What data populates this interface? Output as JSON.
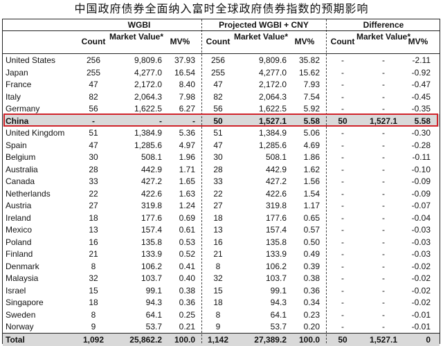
{
  "title": "中国政府债券全面纳入富时全球政府债券指数的预期影响",
  "groups": {
    "wgbi": "WGBI",
    "projected": "Projected WGBI + CNY",
    "difference": "Difference"
  },
  "subheaders": {
    "wgbi": [
      "Count",
      "Market Value*",
      "MV%"
    ],
    "projected": [
      "Count",
      "Market Value*",
      "MV%"
    ],
    "difference": [
      "Count",
      "Market Value*",
      "MV%"
    ]
  },
  "rows": [
    {
      "country": "United States",
      "w_count": "256",
      "w_mv": "9,809.6",
      "w_pct": "37.93",
      "p_count": "256",
      "p_mv": "9,809.6",
      "p_pct": "35.82",
      "d_count": "-",
      "d_mv": "-",
      "d_pct": "-2.11"
    },
    {
      "country": "Japan",
      "w_count": "255",
      "w_mv": "4,277.0",
      "w_pct": "16.54",
      "p_count": "255",
      "p_mv": "4,277.0",
      "p_pct": "15.62",
      "d_count": "-",
      "d_mv": "-",
      "d_pct": "-0.92"
    },
    {
      "country": "France",
      "w_count": "47",
      "w_mv": "2,172.0",
      "w_pct": "8.40",
      "p_count": "47",
      "p_mv": "2,172.0",
      "p_pct": "7.93",
      "d_count": "-",
      "d_mv": "-",
      "d_pct": "-0.47"
    },
    {
      "country": "Italy",
      "w_count": "82",
      "w_mv": "2,064.3",
      "w_pct": "7.98",
      "p_count": "82",
      "p_mv": "2,064.3",
      "p_pct": "7.54",
      "d_count": "-",
      "d_mv": "-",
      "d_pct": "-0.45"
    },
    {
      "country": "Germany",
      "w_count": "56",
      "w_mv": "1,622.5",
      "w_pct": "6.27",
      "p_count": "56",
      "p_mv": "1,622.5",
      "p_pct": "5.92",
      "d_count": "-",
      "d_mv": "-",
      "d_pct": "-0.35"
    },
    {
      "country": "China",
      "w_count": "-",
      "w_mv": "-",
      "w_pct": "-",
      "p_count": "50",
      "p_mv": "1,527.1",
      "p_pct": "5.58",
      "d_count": "50",
      "d_mv": "1,527.1",
      "d_pct": "5.58"
    },
    {
      "country": "United Kingdom",
      "w_count": "51",
      "w_mv": "1,384.9",
      "w_pct": "5.36",
      "p_count": "51",
      "p_mv": "1,384.9",
      "p_pct": "5.06",
      "d_count": "-",
      "d_mv": "-",
      "d_pct": "-0.30"
    },
    {
      "country": "Spain",
      "w_count": "47",
      "w_mv": "1,285.6",
      "w_pct": "4.97",
      "p_count": "47",
      "p_mv": "1,285.6",
      "p_pct": "4.69",
      "d_count": "-",
      "d_mv": "-",
      "d_pct": "-0.28"
    },
    {
      "country": "Belgium",
      "w_count": "30",
      "w_mv": "508.1",
      "w_pct": "1.96",
      "p_count": "30",
      "p_mv": "508.1",
      "p_pct": "1.86",
      "d_count": "-",
      "d_mv": "-",
      "d_pct": "-0.11"
    },
    {
      "country": "Australia",
      "w_count": "28",
      "w_mv": "442.9",
      "w_pct": "1.71",
      "p_count": "28",
      "p_mv": "442.9",
      "p_pct": "1.62",
      "d_count": "-",
      "d_mv": "-",
      "d_pct": "-0.10"
    },
    {
      "country": "Canada",
      "w_count": "33",
      "w_mv": "427.2",
      "w_pct": "1.65",
      "p_count": "33",
      "p_mv": "427.2",
      "p_pct": "1.56",
      "d_count": "-",
      "d_mv": "-",
      "d_pct": "-0.09"
    },
    {
      "country": "Netherlands",
      "w_count": "22",
      "w_mv": "422.6",
      "w_pct": "1.63",
      "p_count": "22",
      "p_mv": "422.6",
      "p_pct": "1.54",
      "d_count": "-",
      "d_mv": "-",
      "d_pct": "-0.09"
    },
    {
      "country": "Austria",
      "w_count": "27",
      "w_mv": "319.8",
      "w_pct": "1.24",
      "p_count": "27",
      "p_mv": "319.8",
      "p_pct": "1.17",
      "d_count": "-",
      "d_mv": "-",
      "d_pct": "-0.07"
    },
    {
      "country": "Ireland",
      "w_count": "18",
      "w_mv": "177.6",
      "w_pct": "0.69",
      "p_count": "18",
      "p_mv": "177.6",
      "p_pct": "0.65",
      "d_count": "-",
      "d_mv": "-",
      "d_pct": "-0.04"
    },
    {
      "country": "Mexico",
      "w_count": "13",
      "w_mv": "157.4",
      "w_pct": "0.61",
      "p_count": "13",
      "p_mv": "157.4",
      "p_pct": "0.57",
      "d_count": "-",
      "d_mv": "-",
      "d_pct": "-0.03"
    },
    {
      "country": "Poland",
      "w_count": "16",
      "w_mv": "135.8",
      "w_pct": "0.53",
      "p_count": "16",
      "p_mv": "135.8",
      "p_pct": "0.50",
      "d_count": "-",
      "d_mv": "-",
      "d_pct": "-0.03"
    },
    {
      "country": "Finland",
      "w_count": "21",
      "w_mv": "133.9",
      "w_pct": "0.52",
      "p_count": "21",
      "p_mv": "133.9",
      "p_pct": "0.49",
      "d_count": "-",
      "d_mv": "-",
      "d_pct": "-0.03"
    },
    {
      "country": "Denmark",
      "w_count": "8",
      "w_mv": "106.2",
      "w_pct": "0.41",
      "p_count": "8",
      "p_mv": "106.2",
      "p_pct": "0.39",
      "d_count": "-",
      "d_mv": "-",
      "d_pct": "-0.02"
    },
    {
      "country": "Malaysia",
      "w_count": "32",
      "w_mv": "103.7",
      "w_pct": "0.40",
      "p_count": "32",
      "p_mv": "103.7",
      "p_pct": "0.38",
      "d_count": "-",
      "d_mv": "-",
      "d_pct": "-0.02"
    },
    {
      "country": "Israel",
      "w_count": "15",
      "w_mv": "99.1",
      "w_pct": "0.38",
      "p_count": "15",
      "p_mv": "99.1",
      "p_pct": "0.36",
      "d_count": "-",
      "d_mv": "-",
      "d_pct": "-0.02"
    },
    {
      "country": "Singapore",
      "w_count": "18",
      "w_mv": "94.3",
      "w_pct": "0.36",
      "p_count": "18",
      "p_mv": "94.3",
      "p_pct": "0.34",
      "d_count": "-",
      "d_mv": "-",
      "d_pct": "-0.02"
    },
    {
      "country": "Sweden",
      "w_count": "8",
      "w_mv": "64.1",
      "w_pct": "0.25",
      "p_count": "8",
      "p_mv": "64.1",
      "p_pct": "0.23",
      "d_count": "-",
      "d_mv": "-",
      "d_pct": "-0.01"
    },
    {
      "country": "Norway",
      "w_count": "9",
      "w_mv": "53.7",
      "w_pct": "0.21",
      "p_count": "9",
      "p_mv": "53.7",
      "p_pct": "0.20",
      "d_count": "-",
      "d_mv": "-",
      "d_pct": "-0.01"
    }
  ],
  "total": {
    "country": "Total",
    "w_count": "1,092",
    "w_mv": "25,862.2",
    "w_pct": "100.0",
    "p_count": "1,142",
    "p_mv": "27,389.2",
    "p_pct": "100.0",
    "d_count": "50",
    "d_mv": "1,527.1",
    "d_pct": "0"
  },
  "colors": {
    "highlight_border": "#d0232a",
    "highlight_fill": "#d9d9d9"
  }
}
